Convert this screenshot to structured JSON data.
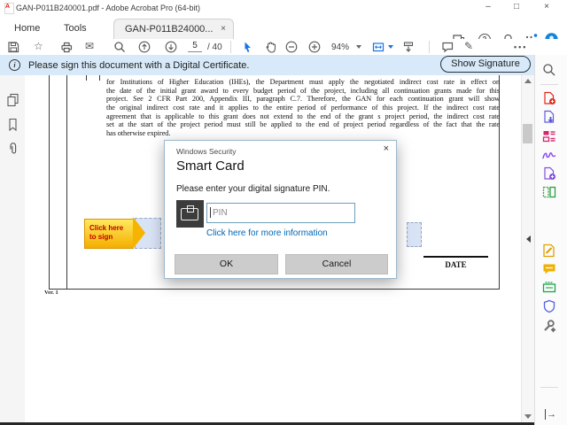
{
  "window": {
    "title": "GAN-P011B240001.pdf - Adobe Acrobat Pro (64-bit)",
    "minimize": "–",
    "maximize": "□",
    "close": "×"
  },
  "tabs": {
    "home": "Home",
    "tools": "Tools",
    "document": "GAN-P011B24000...",
    "close": "×"
  },
  "toolbar": {
    "page_current": "5",
    "page_total": "/ 40",
    "zoom_level": "94%",
    "more": "•••"
  },
  "notification": {
    "info": "i",
    "message": "Please sign this document with a Digital Certificate.",
    "action": "Show Signature"
  },
  "document": {
    "lines": [
      "for Institutions of Higher Education (IHEs), the Department must apply the negotiated indirect cost rate in effect on",
      "the date of the initial grant award to every budget period of the project, including all continuation grants made for this",
      "project. See 2 CFR Part 200, Appendix III, paragraph C.7. Therefore, the GAN for each continuation grant will show",
      "the original indirect cost rate and it applies to the entire period of performance of this project. If the indirect cost rate",
      "agreement that is applicable to this grant does not extend to the end of the grant s project period, the indirect cost rate",
      "set at the start of the project period must still be applied to the end of project period regardless of the fact that the rate",
      "has otherwise expired."
    ],
    "callout_line1": "Click here",
    "callout_line2": "to sign",
    "date_label": "DATE",
    "version_label": "Ver. 1"
  },
  "dialog": {
    "header": "Windows Security",
    "close": "×",
    "title": "Smart Card",
    "prompt": "Please enter your digital signature PIN.",
    "pin_placeholder": "PIN",
    "link": "Click here for more information",
    "ok": "OK",
    "cancel": "Cancel"
  },
  "colors": {
    "accent_blue": "#1473e6",
    "link_blue": "#0066b4",
    "notification_bg": "#d8eaf9",
    "callout_red": "#c00000"
  }
}
